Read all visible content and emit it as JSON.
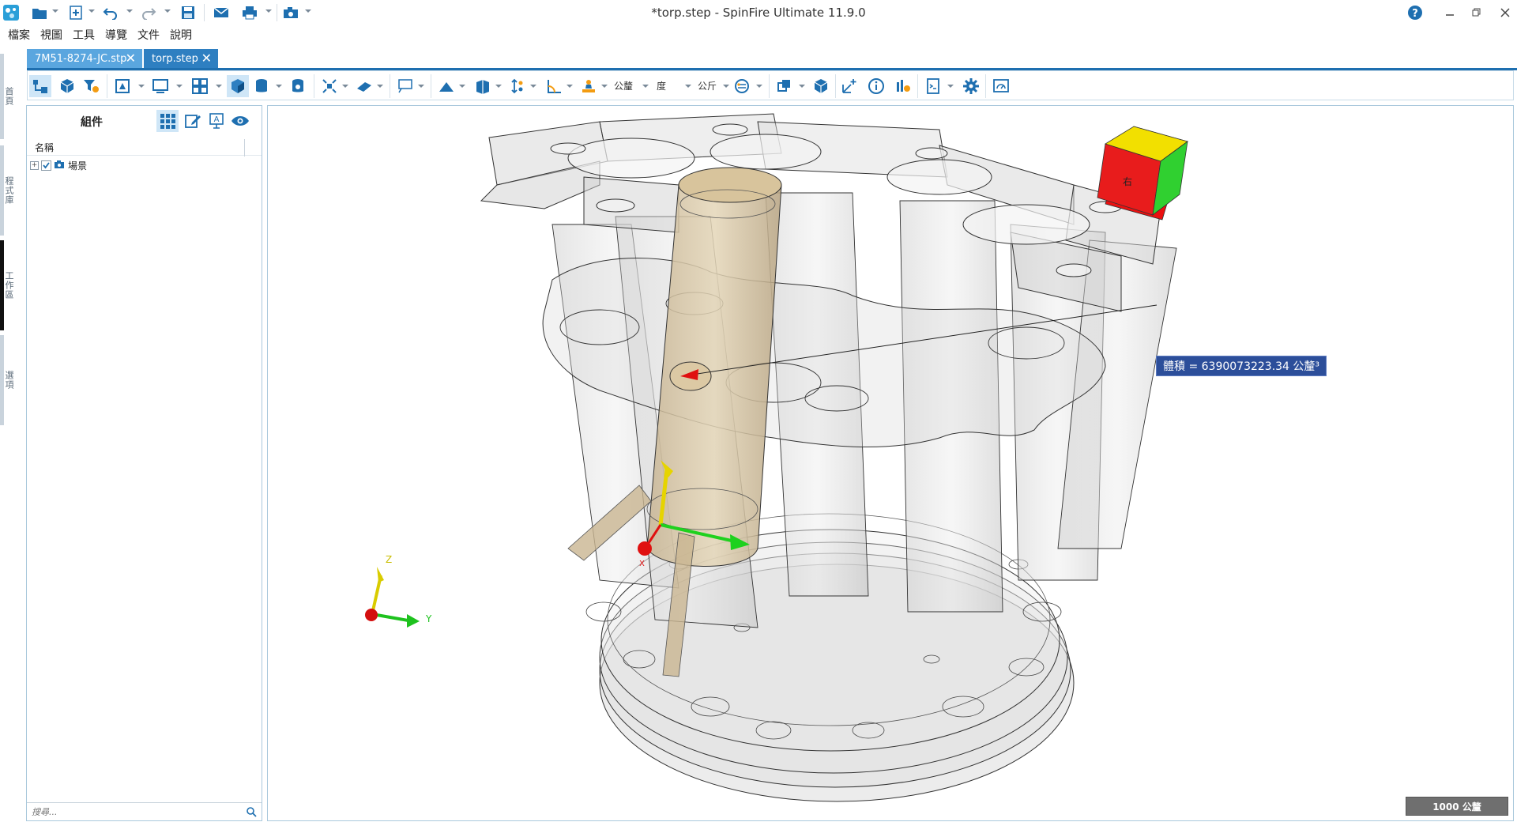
{
  "window": {
    "title": "*torp.step - SpinFire Ultimate 11.9.0"
  },
  "menu": [
    "檔案",
    "視圖",
    "工具",
    "導覽",
    "文件",
    "說明"
  ],
  "side_tabs": [
    "首頁",
    "程式庫",
    "工作區",
    "選項"
  ],
  "doc_tabs": [
    {
      "label": "7M51-8274-JC.stp",
      "active": false
    },
    {
      "label": "torp.step",
      "active": true
    }
  ],
  "ribbon": {
    "unit_length": "公釐",
    "unit_angle": "度",
    "unit_mass": "公斤"
  },
  "left_panel": {
    "title": "組件",
    "column_name": "名稱",
    "tree_root": "場景",
    "search_placeholder": "搜尋..."
  },
  "viewport": {
    "measure_label": "體積 = 6390073223.34 公釐³",
    "scale_label": "1000 公釐",
    "view_cube_face": "右",
    "axes": {
      "x": "X",
      "y": "Y",
      "z": "Z"
    }
  },
  "colors": {
    "accent": "#1e6fb0",
    "tab_inactive": "#5aa6df",
    "tab_active": "#2e7fc1",
    "measure_bg": "#2c4e9a"
  }
}
